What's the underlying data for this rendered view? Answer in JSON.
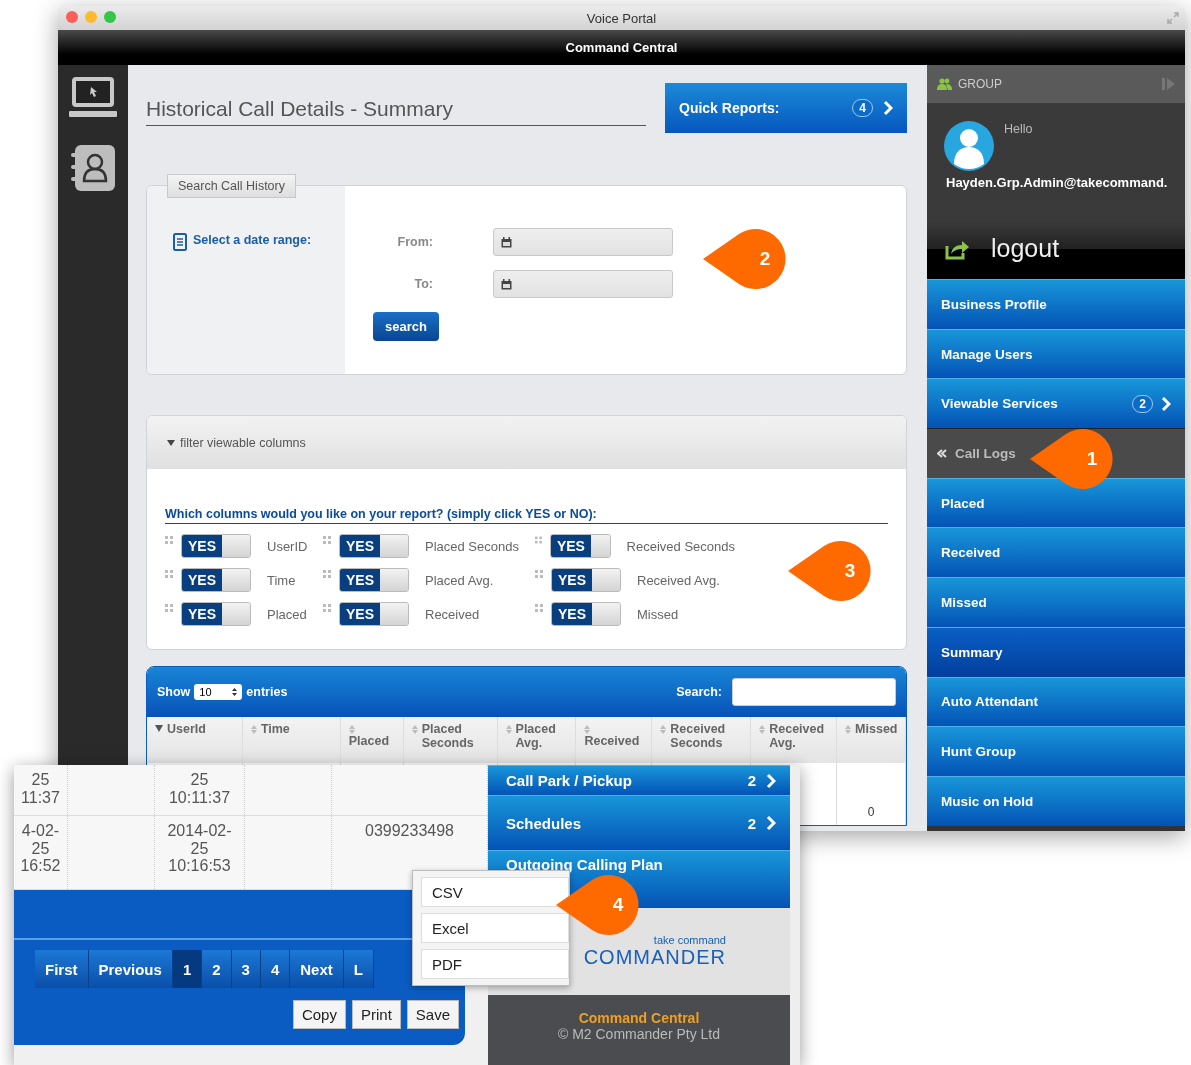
{
  "window": {
    "title": "Voice Portal"
  },
  "app_header": {
    "title": "Command Central"
  },
  "page": {
    "title": "Historical Call Details - Summary"
  },
  "quick_reports": {
    "label": "Quick Reports:",
    "count": "4"
  },
  "search_panel": {
    "tab": "Search Call History",
    "heading": "Select a date range:",
    "fields": [
      {
        "label": "From:"
      },
      {
        "label": "To:"
      }
    ],
    "button": "search"
  },
  "filter": {
    "title": "filter viewable columns",
    "expanded": true,
    "question": "Which columns would you like on your report? (simply click YES or NO):",
    "columns": [
      {
        "label": "UserID",
        "toggle": "YES",
        "on": true
      },
      {
        "label": "Placed Seconds",
        "toggle": "YES",
        "on": true
      },
      {
        "label": "Received Seconds",
        "toggle": "YES",
        "on": true
      },
      {
        "label": "Time",
        "toggle": "YES",
        "on": true
      },
      {
        "label": "Placed Avg.",
        "toggle": "YES",
        "on": true
      },
      {
        "label": "Received Avg.",
        "toggle": "YES",
        "on": true
      },
      {
        "label": "Placed",
        "toggle": "YES",
        "on": true
      },
      {
        "label": "Received",
        "toggle": "YES",
        "on": true
      },
      {
        "label": "Missed",
        "toggle": "YES",
        "on": true
      }
    ]
  },
  "table": {
    "show_label": "Show",
    "page_size": "10",
    "entries_label": "entries",
    "search_label": "Search:",
    "columns": [
      {
        "label": "UserId",
        "sorted": true
      },
      {
        "label": "Time",
        "sorted": false
      },
      {
        "label": "Placed",
        "sorted": false
      },
      {
        "label": "Placed Seconds",
        "sorted": false
      },
      {
        "label": "Placed Avg.",
        "sorted": false
      },
      {
        "label": "Received",
        "sorted": false
      },
      {
        "label": "Received Seconds",
        "sorted": false
      },
      {
        "label": "Received Avg.",
        "sorted": false
      },
      {
        "label": "Missed",
        "sorted": false
      }
    ],
    "partial_row": {
      "missed": "0"
    }
  },
  "sidebar": {
    "section": "GROUP",
    "greeting": "Hello",
    "user": "Hayden.Grp.Admin@takecommand.",
    "logout": "logout",
    "items": [
      {
        "label": "Business Profile",
        "kind": "link",
        "selected": false
      },
      {
        "label": "Manage Users",
        "kind": "link",
        "selected": false
      },
      {
        "label": "Viewable Services",
        "kind": "link",
        "count": "2",
        "selected": false
      },
      {
        "label": "Call Logs",
        "kind": "back",
        "selected": false
      },
      {
        "label": "Placed",
        "kind": "link",
        "selected": false
      },
      {
        "label": "Received",
        "kind": "link",
        "selected": false
      },
      {
        "label": "Missed",
        "kind": "link",
        "selected": false
      },
      {
        "label": "Summary",
        "kind": "link",
        "selected": true
      },
      {
        "label": "Auto Attendant",
        "kind": "link",
        "selected": false
      },
      {
        "label": "Hunt Group",
        "kind": "link",
        "selected": false
      },
      {
        "label": "Music on Hold",
        "kind": "link",
        "selected": false
      }
    ]
  },
  "inset": {
    "rows": [
      {
        "cells": [
          "25\n11:37",
          "",
          "25\n10:11:37",
          "",
          ""
        ]
      },
      {
        "cells": [
          "4-02-\n25\n16:52",
          "",
          "2014-02-\n25\n10:16:53",
          "",
          "0399233498"
        ]
      }
    ],
    "pagination": [
      {
        "label": "First",
        "selected": false
      },
      {
        "label": "Previous",
        "selected": false
      },
      {
        "label": "1",
        "selected": true
      },
      {
        "label": "2",
        "selected": false
      },
      {
        "label": "3",
        "selected": false
      },
      {
        "label": "4",
        "selected": false
      },
      {
        "label": "Next",
        "selected": false
      },
      {
        "label": "L",
        "selected": false
      }
    ],
    "buttons": [
      "Copy",
      "Print",
      "Save"
    ],
    "save_menu": [
      "CSV",
      "Excel",
      "PDF"
    ],
    "sidebar_items": [
      {
        "label": "Call Park / Pickup",
        "count": "2"
      },
      {
        "label": "Schedules",
        "count": "2"
      },
      {
        "label": "Outgoing Calling Plan"
      }
    ],
    "logo": {
      "tagline": "take command",
      "name": "COMMANDER"
    },
    "footer": {
      "title": "Command Central",
      "copyright": "© M2 Commander Pty Ltd"
    }
  },
  "callouts": [
    {
      "number": "2"
    },
    {
      "number": "1"
    },
    {
      "number": "3"
    },
    {
      "number": "4"
    }
  ]
}
